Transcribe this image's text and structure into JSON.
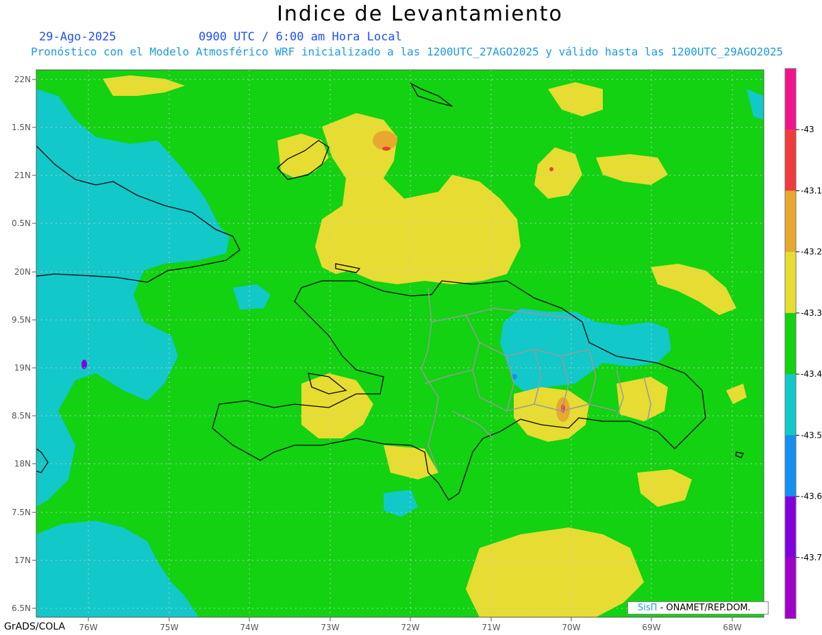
{
  "header": {
    "title": "Indice de Levantamiento",
    "date": "29-Ago-2025",
    "time": "0900 UTC / 6:00 am Hora Local",
    "subtitle": "Pronóstico con el Modelo Atmosférico WRF inicializado a las 1200UTC_27AGO2025 y válido hasta las  1200UTC_29AGO2025"
  },
  "axes": {
    "lat_labels": [
      "22N",
      "1.5N",
      "21N",
      "0.5N",
      "20N",
      "9.5N",
      "19N",
      "8.5N",
      "18N",
      "7.5N",
      "17N",
      "6.5N"
    ],
    "lon_labels": [
      "76W",
      "75W",
      "74W",
      "73W",
      "72W",
      "71W",
      "70W",
      "69W",
      "68W"
    ]
  },
  "colorbar": {
    "labels": [
      "-43",
      "-43.1",
      "-43.2",
      "-43.3",
      "-43.4",
      "-43.5",
      "-43.6",
      "-43.7"
    ],
    "colors": [
      "#f0148c",
      "#f03c3c",
      "#e8a830",
      "#e6dc32",
      "#12d212",
      "#12c8c8",
      "#1490f0",
      "#8200dc",
      "#a000c8"
    ]
  },
  "field_colors": {
    "base": "#12d212",
    "cyan": "#12c8c8",
    "yellow": "#e6dc32",
    "orange": "#e8a830",
    "red": "#f03c3c",
    "blue": "#1490f0",
    "purple": "#8200dc"
  },
  "footer": {
    "software": "GrADS/COLA",
    "credit_brand": "SisΠ",
    "credit_rest": "- ONAMET/REP.DOM."
  }
}
